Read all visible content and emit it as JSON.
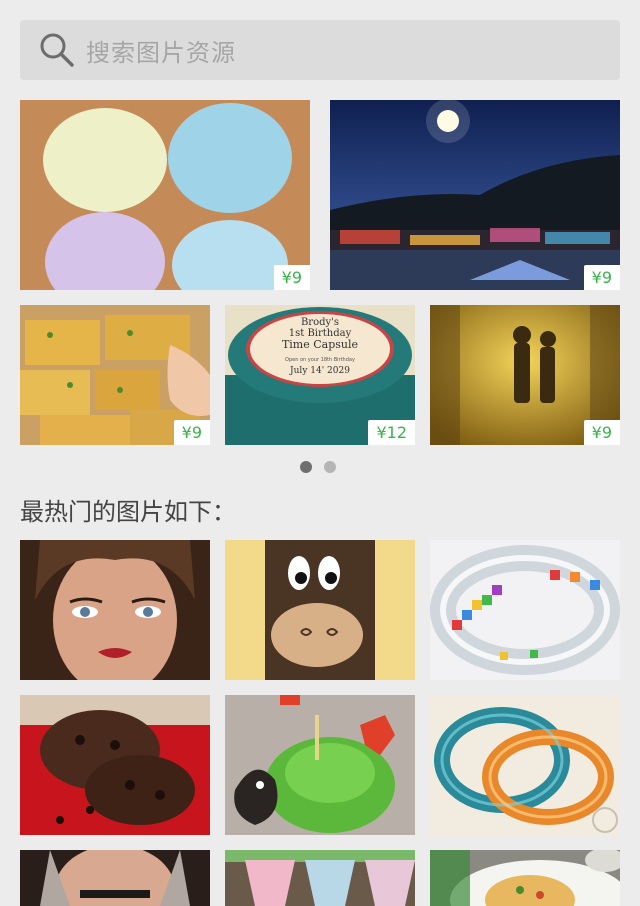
{
  "search": {
    "placeholder": "搜索图片资源",
    "icon": "search-icon"
  },
  "featured": [
    {
      "subject": "pastel-dough-balls",
      "price": "¥9"
    },
    {
      "subject": "night-town-moon",
      "price": "¥9"
    },
    {
      "subject": "cheese-bread-slices",
      "price": "¥9"
    },
    {
      "subject": "time-capsule-tin",
      "price": "¥12",
      "label": {
        "line1": "Brody's",
        "line2": "1st Birthday",
        "line3": "Time Capsule",
        "line4": "Open on your 18th Birthday",
        "line5": "July 14' 2029"
      }
    },
    {
      "subject": "couple-in-golden-light",
      "price": "¥9"
    }
  ],
  "carousel": {
    "page_count": 2,
    "active_index": 0
  },
  "popular": {
    "title": "最热门的图片如下：",
    "items": [
      "woman-portrait",
      "paper-bag-monster",
      "tetris-bangle",
      "chocolate-cookies",
      "monster-cupcake",
      "colored-bangles",
      "woman-portrait-2",
      "tea-banner",
      "food-plate"
    ]
  },
  "colors": {
    "price": "#39b54a",
    "background": "#ececec",
    "search_bg": "#dcdcdc"
  }
}
